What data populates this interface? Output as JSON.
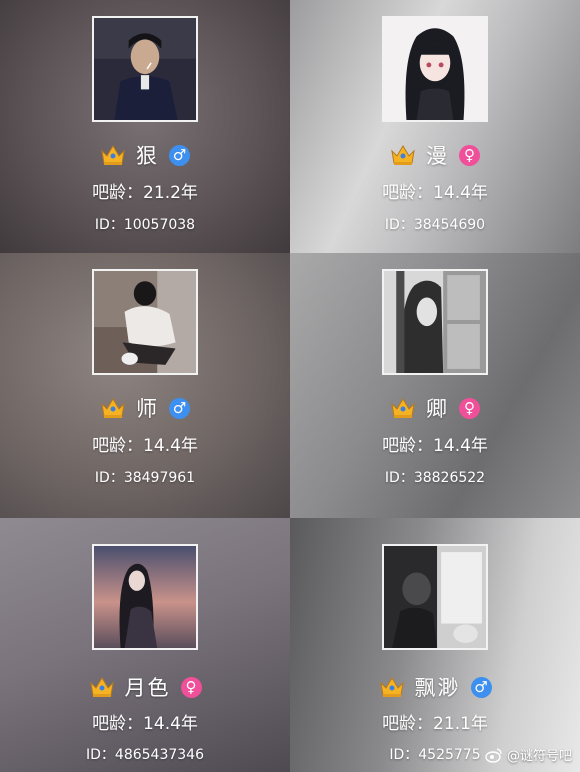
{
  "cards": [
    {
      "name": "狠",
      "gender": "male",
      "gender_symbol": "♂",
      "age": "吧龄：21.2年",
      "id": "ID：10057038",
      "crown_icon": "crown-icon",
      "avatar_icon": "avatar-photo"
    },
    {
      "name": "漫",
      "gender": "female",
      "gender_symbol": "♀",
      "age": "吧龄：14.4年",
      "id": "ID：38454690",
      "crown_icon": "crown-icon",
      "avatar_icon": "avatar-photo"
    },
    {
      "name": "师",
      "gender": "male",
      "gender_symbol": "♂",
      "age": "吧龄：14.4年",
      "id": "ID：38497961",
      "crown_icon": "crown-icon",
      "avatar_icon": "avatar-photo"
    },
    {
      "name": "卿",
      "gender": "female",
      "gender_symbol": "♀",
      "age": "吧龄：14.4年",
      "id": "ID：38826522",
      "crown_icon": "crown-icon",
      "avatar_icon": "avatar-photo"
    },
    {
      "name": "月色",
      "gender": "female",
      "gender_symbol": "♀",
      "age": "吧龄：14.4年",
      "id": "ID：4865437346",
      "crown_icon": "crown-icon",
      "avatar_icon": "avatar-photo"
    },
    {
      "name": "飘渺",
      "gender": "male",
      "gender_symbol": "♂",
      "age": "吧龄：21.1年",
      "id": "ID：4525775",
      "crown_icon": "crown-icon",
      "avatar_icon": "avatar-photo"
    }
  ],
  "watermark": {
    "text": "@谜符号吧",
    "icon": "weibo-logo-icon"
  },
  "colors": {
    "male": "#3d8ff0",
    "female": "#f04f9a",
    "crown_gold": "#f5b324",
    "text": "#ffffff"
  }
}
